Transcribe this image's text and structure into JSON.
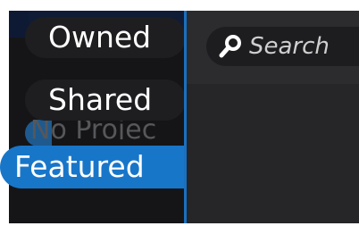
{
  "sidebar": {
    "items": [
      {
        "label": "Owned"
      },
      {
        "label": "Shared"
      },
      {
        "label": "Featured",
        "selected": true
      }
    ],
    "empty_state": "No Projec"
  },
  "search": {
    "placeholder": "Search",
    "icon": "search-icon"
  },
  "colors": {
    "accent": "#1876c9",
    "sidebar_bg": "#151517",
    "pill_bg": "#1e1e21",
    "main_bg": "#2a2a2d"
  }
}
